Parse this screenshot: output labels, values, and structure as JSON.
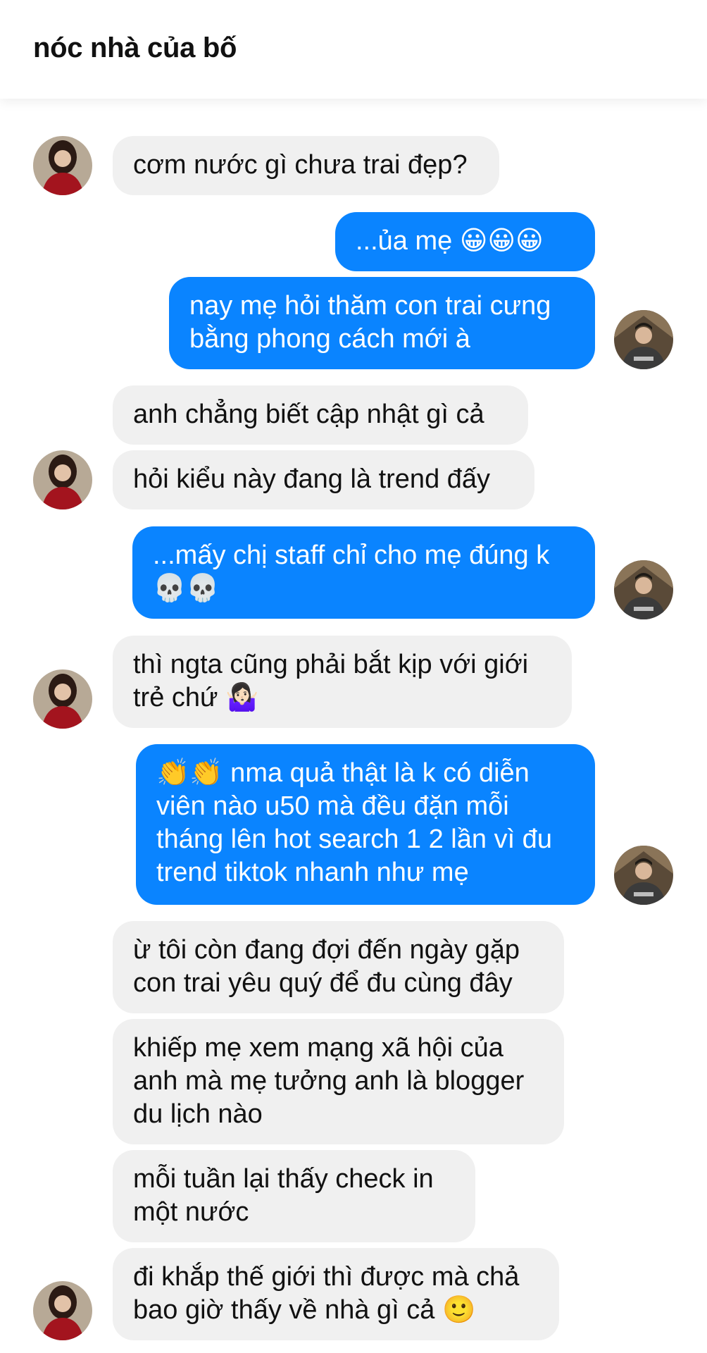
{
  "header": {
    "title": "nóc nhà của bố"
  },
  "colors": {
    "incoming_bubble": "#f0f0f0",
    "outgoing_bubble": "#0a84ff",
    "incoming_text": "#111111",
    "outgoing_text": "#ffffff"
  },
  "messages": [
    {
      "sender": "mother",
      "text": "cơm nước gì chưa trai đẹp?"
    },
    {
      "sender": "son",
      "text": "...ủa mẹ 😀😀😀"
    },
    {
      "sender": "son",
      "text": "nay mẹ hỏi thăm con trai cưng\nbằng phong cách mới à"
    },
    {
      "sender": "mother",
      "text": "anh chẳng biết cập nhật gì cả"
    },
    {
      "sender": "mother",
      "text": "hỏi kiểu này đang là trend đấy"
    },
    {
      "sender": "son",
      "text": "...mấy chị staff chỉ cho mẹ đúng k\n💀💀"
    },
    {
      "sender": "mother",
      "text": "thì ngta cũng phải bắt kịp với giới\ntrẻ chứ 🤷🏻‍♀️"
    },
    {
      "sender": "son",
      "text": "👏👏 nma quả thật là k có diễn\nviên nào u50 mà đều đặn mỗi\ntháng lên hot search 1 2 lần vì đu\ntrend tiktok nhanh như mẹ"
    },
    {
      "sender": "mother",
      "text": "ừ tôi còn đang đợi đến ngày gặp\ncon trai yêu quý để đu cùng đây"
    },
    {
      "sender": "mother",
      "text": "khiếp mẹ xem mạng xã hội của\nanh mà mẹ tưởng anh là blogger\ndu lịch nào"
    },
    {
      "sender": "mother",
      "text": "mỗi tuần lại thấy check in\nmột nước"
    },
    {
      "sender": "mother",
      "text": "đi khắp thế giới thì được mà chả\nbao giờ thấy về nhà gì cả 🙂"
    }
  ]
}
